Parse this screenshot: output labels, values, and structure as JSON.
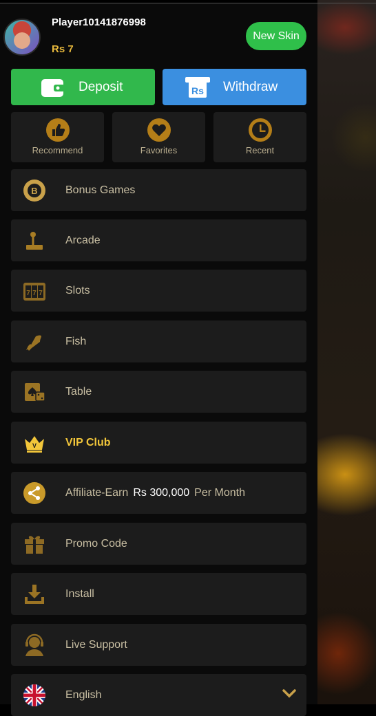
{
  "header": {
    "username": "Player10141876998",
    "balance": "Rs 7",
    "new_skin_label": "New Skin"
  },
  "actions": {
    "deposit_label": "Deposit",
    "withdraw_label": "Withdraw",
    "withdraw_icon_text": "Rs"
  },
  "quick_links": [
    {
      "label": "Recommend",
      "icon": "thumbs-up-icon"
    },
    {
      "label": "Favorites",
      "icon": "heart-icon"
    },
    {
      "label": "Recent",
      "icon": "clock-icon"
    }
  ],
  "menu": {
    "bonus_games": "Bonus Games",
    "arcade": "Arcade",
    "slots": "Slots",
    "fish": "Fish",
    "table": "Table",
    "vip_club": "VIP Club",
    "affiliate_prefix": "Affiliate-Earn",
    "affiliate_amount": "Rs 300,000",
    "affiliate_suffix": "Per Month",
    "promo_code": "Promo Code",
    "install": "Install",
    "live_support": "Live Support",
    "language": "English"
  },
  "colors": {
    "accent_gold": "#e8b93c",
    "deposit_green": "#31b84c",
    "withdraw_blue": "#3b8fe0",
    "item_bg": "#1c1c1c"
  }
}
